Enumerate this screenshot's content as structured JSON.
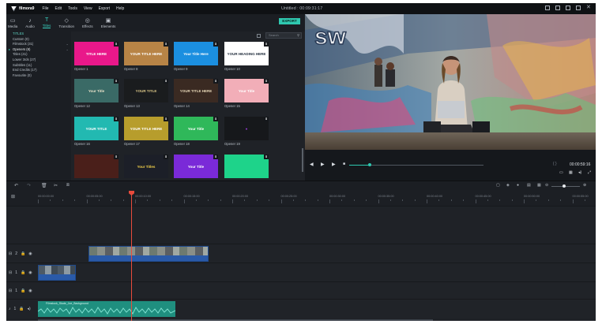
{
  "app": {
    "name": "filmora9",
    "menu": [
      "File",
      "Edit",
      "Tools",
      "View",
      "Export",
      "Help"
    ],
    "title": "Untitled : 00:09:31:17",
    "export_label": "EXPORT"
  },
  "tabs": [
    {
      "label": "Media",
      "icon": "folder-icon"
    },
    {
      "label": "Audio",
      "icon": "music-note-icon"
    },
    {
      "label": "Titles",
      "icon": "text-icon",
      "active": true
    },
    {
      "label": "Transition",
      "icon": "transition-icon"
    },
    {
      "label": "Effects",
      "icon": "effects-icon"
    },
    {
      "label": "Elements",
      "icon": "elements-icon"
    }
  ],
  "categories": {
    "header": "TITLES",
    "items": [
      {
        "label": "Custom (0)"
      },
      {
        "label": "Filmstock (31)"
      },
      {
        "label": "Openers (8)",
        "active": true
      },
      {
        "label": "Titles (41)"
      },
      {
        "label": "Lower 3rds (27)"
      },
      {
        "label": "Subtitles (11)"
      },
      {
        "label": "End Credits (17)"
      },
      {
        "label": "Favourite (0)"
      }
    ]
  },
  "search": {
    "placeholder": "Search"
  },
  "thumbnails": [
    {
      "caption": "Opener 1",
      "text": "TITLE HERE",
      "bg": "#e9188a",
      "fg": "#ffffff"
    },
    {
      "caption": "Opener 8",
      "text": "YOUR TITLE HERE",
      "bg": "#b88446",
      "fg": "#ffffff"
    },
    {
      "caption": "Opener 9",
      "text": "Your Title Here",
      "bg": "#1b8fe0",
      "fg": "#ffffff"
    },
    {
      "caption": "Opener 10",
      "text": "YOUR HEADING HERE",
      "bg": "#ffffff",
      "fg": "#1e2a3a"
    },
    {
      "caption": "Opener 12",
      "text": "Your Title",
      "bg": "#3a6a66",
      "fg": "#e8e2c9"
    },
    {
      "caption": "Opener 13",
      "text": "YOUR TITLE",
      "bg": "#1a1c1e",
      "fg": "#d8c486"
    },
    {
      "caption": "Opener 14",
      "text": "YOUR TITLE HERE",
      "bg": "#3a2a22",
      "fg": "#e8d8b8"
    },
    {
      "caption": "Opener 15",
      "text": "Your Title",
      "bg": "#f2aeb8",
      "fg": "#ffffff"
    },
    {
      "caption": "Opener 16",
      "text": "YOUR TITLE",
      "bg": "#22b9b1",
      "fg": "#ffffff"
    },
    {
      "caption": "Opener 17",
      "text": "YOUR TITLE HERE",
      "bg": "#b79d2c",
      "fg": "#ffffff"
    },
    {
      "caption": "Opener 18",
      "text": "Your Title",
      "bg": "#2fb85a",
      "fg": "#ffffff"
    },
    {
      "caption": "Opener 19",
      "text": "●",
      "bg": "#16181b",
      "fg": "#9b3ddb"
    },
    {
      "caption": "",
      "text": "",
      "bg": "#4a1f1a",
      "fg": "#ffffff"
    },
    {
      "caption": "",
      "text": "Your Titles",
      "bg": "#1c1f28",
      "fg": "#f4d24a"
    },
    {
      "caption": "",
      "text": "Your Title",
      "bg": "#7a2ad8",
      "fg": "#ffffff"
    },
    {
      "caption": "",
      "text": "",
      "bg": "#1ed38a",
      "fg": "#ffffff"
    }
  ],
  "player": {
    "timecode": "00:00:59:16",
    "progress": 0.15,
    "labels": {
      "play": "▶",
      "prev": "◀",
      "next": "▶▶",
      "stop": "■"
    }
  },
  "timeline": {
    "ruler": [
      "00:00:00:00",
      "00:00:05:00",
      "00:00:10:00",
      "00:00:15:00",
      "00:00:20:00",
      "00:00:25:00",
      "00:00:30:00",
      "00:00:35:00",
      "00:00:40:00",
      "00:00:45:00",
      "00:00:50:00",
      "00:00:55:00"
    ],
    "tracks": [
      {
        "label": "2",
        "kind": "video"
      },
      {
        "label": "1",
        "kind": "video"
      },
      {
        "label": "1",
        "kind": "music"
      },
      {
        "label": "1",
        "kind": "audio"
      }
    ],
    "audio_clip_label": "Filmstock_Skate_Joe_Background"
  },
  "colors": {
    "accent": "#2fc8b0",
    "playhead": "#e84b3c",
    "video_clip": "#2a5aa8",
    "audio_clip": "#1f8f7f"
  }
}
